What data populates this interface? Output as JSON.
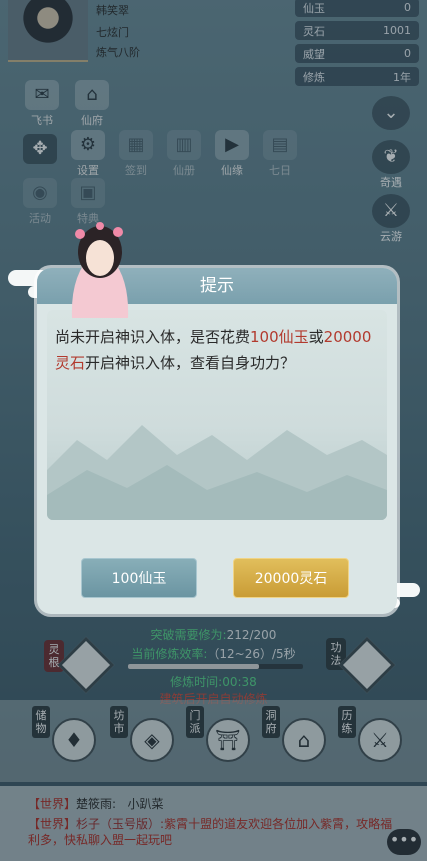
{
  "player": {
    "name": "韩笑翠",
    "sect": "七炫门",
    "realm": "炼气八阶"
  },
  "resources": [
    {
      "label": "仙玉",
      "value": "0"
    },
    {
      "label": "灵石",
      "value": "1001"
    },
    {
      "label": "威望",
      "value": "0"
    },
    {
      "label": "修炼",
      "value": "1年"
    }
  ],
  "top_menu": {
    "row1": [
      {
        "label": "飞书",
        "icon": "envelope-icon"
      },
      {
        "label": "仙府",
        "icon": "house-icon"
      }
    ],
    "row2": [
      {
        "label": "",
        "icon": "move-cross-icon"
      },
      {
        "label": "设置",
        "icon": "gear-icon"
      },
      {
        "label": "签到",
        "icon": "calendar-icon"
      },
      {
        "label": "仙册",
        "icon": "book-icon"
      },
      {
        "label": "仙缘",
        "icon": "play-icon"
      },
      {
        "label": "七日",
        "icon": "scroll-icon"
      }
    ],
    "row3": [
      {
        "label": "活动",
        "icon": "lantern-icon"
      },
      {
        "label": "特典",
        "icon": "gift-icon"
      }
    ]
  },
  "right_menu": [
    {
      "label": "",
      "icon": "chevron-down-icon"
    },
    {
      "label": "奇遇",
      "icon": "leaf-icon"
    },
    {
      "label": "云游",
      "icon": "sword-icon"
    }
  ],
  "dialog": {
    "title": "提示",
    "message_parts": {
      "p1": "尚未开启神识入体，是否花费",
      "cost1": "100仙玉",
      "p2": "或",
      "cost2": "20000灵石",
      "p3": "开启神识入体，查看自身功力？"
    },
    "btn_jade": "100仙玉",
    "btn_stone": "20000灵石"
  },
  "cultivation": {
    "breakthrough_label": "突破需要修为:",
    "breakthrough_value": "212/200",
    "efficiency_label": "当前修炼效率:",
    "efficiency_value": "（12~26）/5秒",
    "progress_fraction": 0.75,
    "time_label": "修炼时间:",
    "time_value": "00:38",
    "auto_hint": "建筑后开启自动修炼",
    "left_tag": "灵根",
    "right_tag": "功法"
  },
  "bottom_menu": [
    {
      "label": "储物",
      "icon": "bag-icon"
    },
    {
      "label": "坊市",
      "icon": "ingot-icon"
    },
    {
      "label": "门派",
      "icon": "gate-icon"
    },
    {
      "label": "洞府",
      "icon": "pavilion-icon"
    },
    {
      "label": "历练",
      "icon": "crossed-swords-icon"
    }
  ],
  "chat": {
    "row1": {
      "channel": "【世界】",
      "name": "楚筱雨:",
      "text": "小趴菜"
    },
    "row2": {
      "channel": "【世界】",
      "name": "杉子（玉号版）:",
      "text": "紫霄十盟的道友欢迎各位加入紫霄，攻略福利多，快私聊入盟一起玩吧"
    },
    "more": "•••"
  }
}
